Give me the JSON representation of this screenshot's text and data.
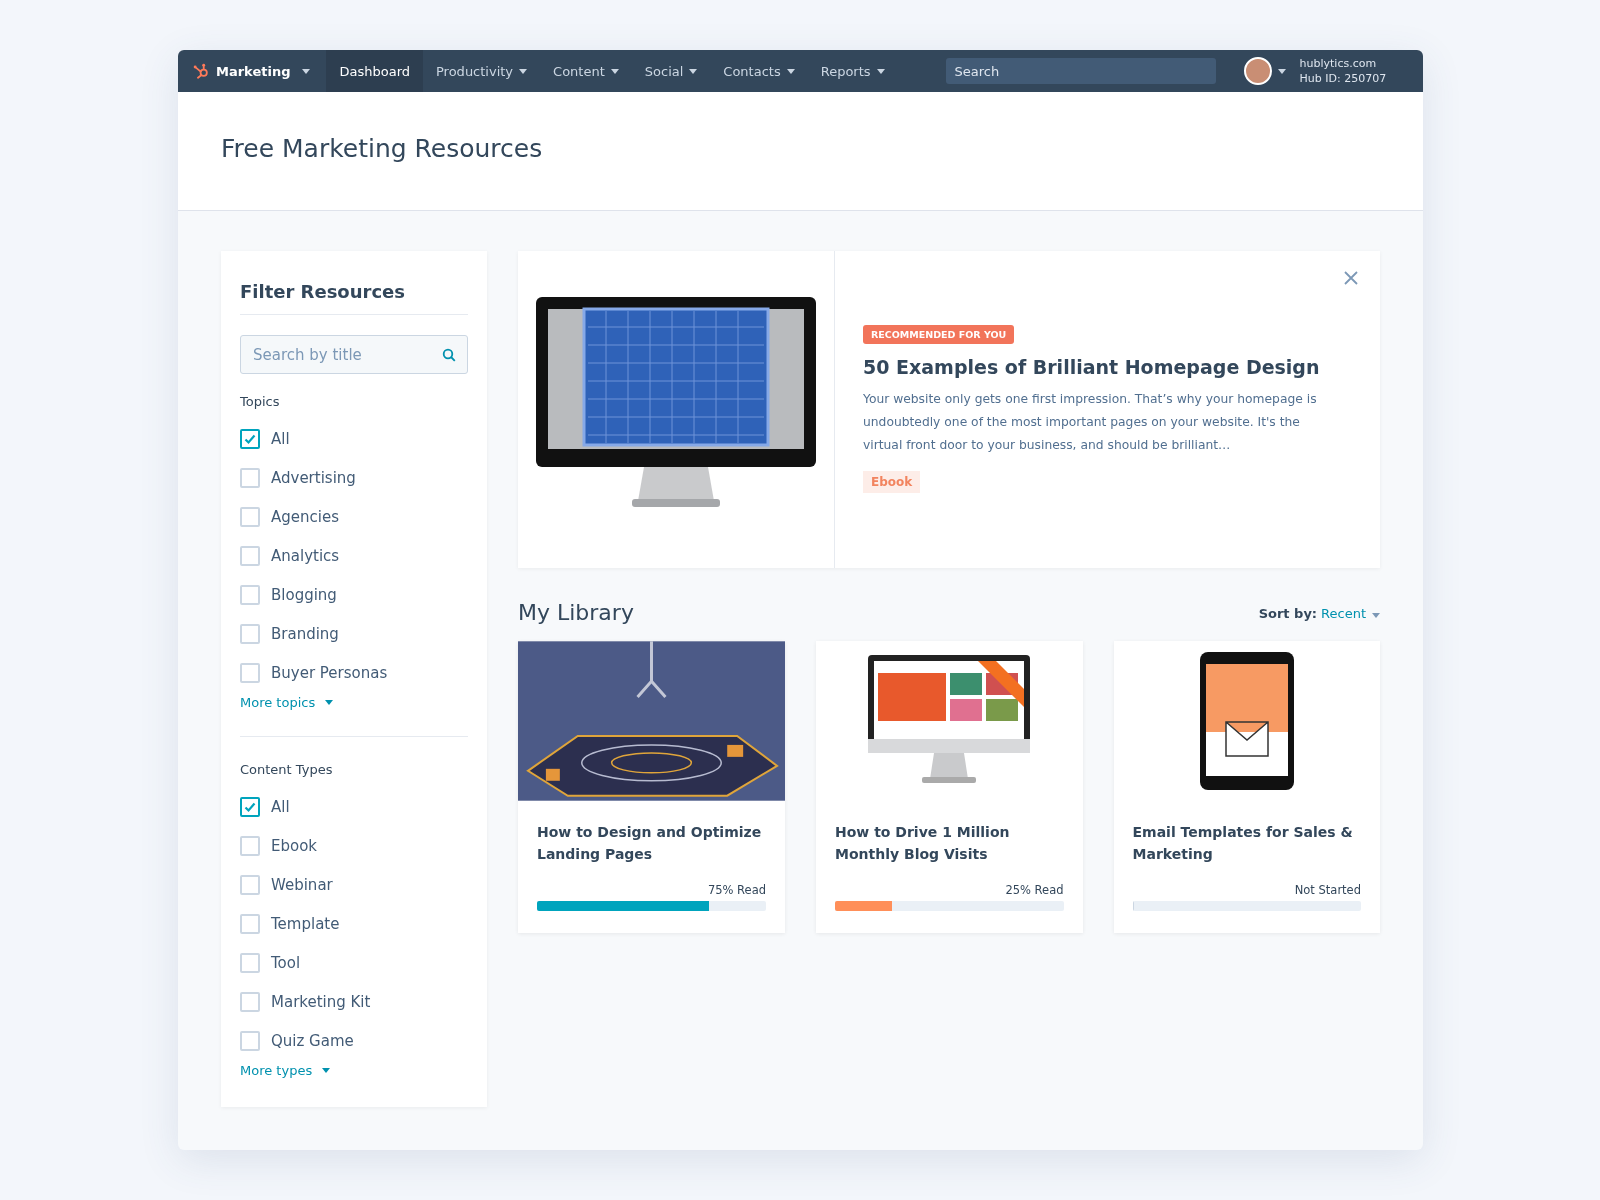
{
  "nav": {
    "brand": "Marketing",
    "items": [
      {
        "label": "Dashboard",
        "selected": true,
        "dropdown": false
      },
      {
        "label": "Productivity",
        "selected": false,
        "dropdown": true
      },
      {
        "label": "Content",
        "selected": false,
        "dropdown": true
      },
      {
        "label": "Social",
        "selected": false,
        "dropdown": true
      },
      {
        "label": "Contacts",
        "selected": false,
        "dropdown": true
      },
      {
        "label": "Reports",
        "selected": false,
        "dropdown": true
      }
    ],
    "search": {
      "placeholder": "Search"
    },
    "account": {
      "domain": "hublytics.com",
      "hub_id": "Hub ID: 250707"
    }
  },
  "page": {
    "title": "Free Marketing Resources"
  },
  "filter": {
    "title": "Filter Resources",
    "search": {
      "placeholder": "Search by title"
    },
    "groups": [
      {
        "title": "Topics",
        "more": "More topics",
        "options": [
          {
            "label": "All",
            "checked": true
          },
          {
            "label": "Advertising",
            "checked": false
          },
          {
            "label": "Agencies",
            "checked": false
          },
          {
            "label": "Analytics",
            "checked": false
          },
          {
            "label": "Blogging",
            "checked": false
          },
          {
            "label": "Branding",
            "checked": false
          },
          {
            "label": "Buyer Personas",
            "checked": false
          }
        ]
      },
      {
        "title": "Content Types",
        "more": "More types",
        "options": [
          {
            "label": "All",
            "checked": true
          },
          {
            "label": "Ebook",
            "checked": false
          },
          {
            "label": "Webinar",
            "checked": false
          },
          {
            "label": "Template",
            "checked": false
          },
          {
            "label": "Tool",
            "checked": false
          },
          {
            "label": "Marketing Kit",
            "checked": false
          },
          {
            "label": "Quiz Game",
            "checked": false
          }
        ]
      }
    ]
  },
  "featured": {
    "badge": "RECOMMENDED FOR YOU",
    "title": "50 Examples of Brilliant Homepage Design",
    "description": "Your website only gets one first impression. That’s why your homepage is undoubtedly one of the most important pages on your website. It's the virtual front door to your business, and should be brilliant…",
    "tag": "Ebook"
  },
  "library": {
    "title": "My Library",
    "sort_label": "Sort by:",
    "sort_value": "Recent",
    "items": [
      {
        "kind": "landing",
        "title": "How to Design and Optimize Landing Pages",
        "status": "75% Read",
        "level": 0.75,
        "color": "#00a4bd"
      },
      {
        "kind": "monitor",
        "title": "How to Drive 1 Million Monthly Blog Visits",
        "status": "25% Read",
        "level": 0.25,
        "color": "#ff8f59"
      },
      {
        "kind": "tablet",
        "title": "Email Templates for Sales & Marketing",
        "status": "Not Started",
        "level": 0
      }
    ]
  }
}
